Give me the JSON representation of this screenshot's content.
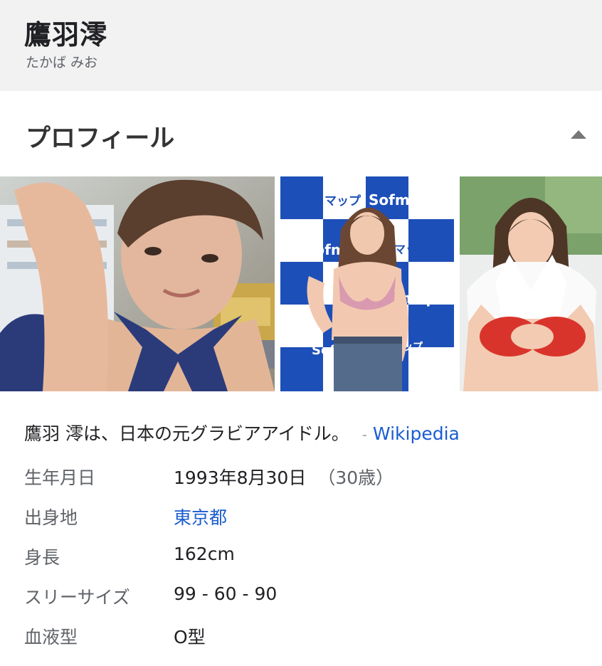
{
  "header": {
    "title": "鷹羽澪",
    "subtitle": "たかば みお"
  },
  "section": {
    "title": "プロフィール",
    "collapse_icon": "chevron-up-icon"
  },
  "gallery": {
    "images": [
      {
        "name": "profile-image-1"
      },
      {
        "name": "profile-image-2",
        "visible_text": [
          "ソフマップ",
          "Sofmap",
          "Sofm",
          "ソフマップ",
          "Sof",
          "map",
          "ップ",
          "ップ"
        ]
      },
      {
        "name": "profile-image-3"
      }
    ]
  },
  "description": {
    "text": "鷹羽 澪は、日本の元グラビアアイドル。",
    "separator": "-",
    "source_link": "Wikipedia"
  },
  "facts": [
    {
      "label": "生年月日",
      "value": "1993年8月30日",
      "extra": "（30歳）",
      "link": false
    },
    {
      "label": "出身地",
      "value": "東京都",
      "link": true
    },
    {
      "label": "身長",
      "value": "162cm",
      "link": false
    },
    {
      "label": "スリーサイズ",
      "value": "99 - 60 - 90",
      "link": false
    },
    {
      "label": "血液型",
      "value": "O型",
      "link": false
    }
  ],
  "colors": {
    "link": "#1a5dd0",
    "header_bg": "#f2f2f2",
    "sofmap_blue": "#1d4fb8"
  }
}
